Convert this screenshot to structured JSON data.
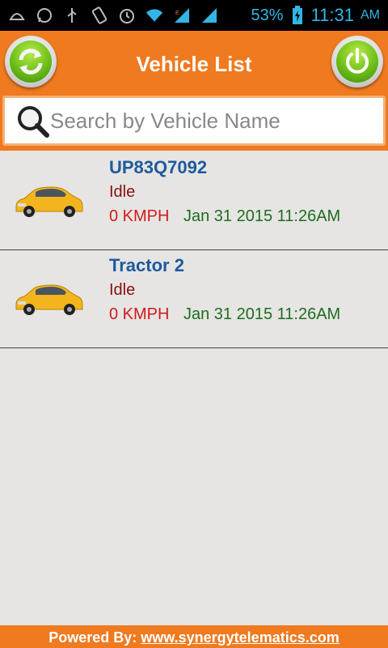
{
  "status_bar": {
    "icons": [
      "notification-icon",
      "whatsapp-icon",
      "usb-icon",
      "vibrate-icon",
      "alarm-icon",
      "wifi-icon",
      "signal-icon",
      "signal-icon",
      "battery-icon"
    ],
    "battery": "53%",
    "time": "11:31",
    "ampm": "AM"
  },
  "header": {
    "title": "Vehicle List",
    "refresh_icon": "refresh-icon",
    "power_icon": "power-icon"
  },
  "search": {
    "placeholder": "Search by Vehicle Name",
    "value": ""
  },
  "vehicles": [
    {
      "name": "UP83Q7092",
      "status": "Idle",
      "speed": "0 KMPH",
      "time": "Jan 31 2015 11:26AM",
      "icon": "car-icon"
    },
    {
      "name": "Tractor 2",
      "status": "Idle",
      "speed": "0 KMPH",
      "time": "Jan 31 2015 11:26AM",
      "icon": "car-icon"
    }
  ],
  "footer": {
    "prefix": "Powered By: ",
    "link": "www.synergytelematics.com"
  },
  "colors": {
    "accent": "#ef7a1f",
    "name": "#1d5a9e",
    "status": "#8b1010",
    "speed": "#d11b1b",
    "time": "#1e6e1e"
  }
}
